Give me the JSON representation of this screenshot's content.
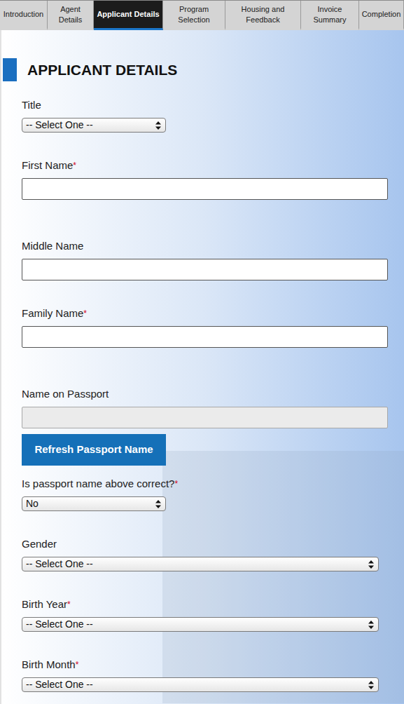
{
  "tabs": [
    {
      "label": "Introduction",
      "selected": false
    },
    {
      "label": "Agent Details",
      "selected": false
    },
    {
      "label": "Applicant Details",
      "selected": true
    },
    {
      "label": "Program Selection",
      "selected": false
    },
    {
      "label": "Housing and Feedback",
      "selected": false
    },
    {
      "label": "Invoice Summary",
      "selected": false
    },
    {
      "label": "Completion",
      "selected": false
    }
  ],
  "section": {
    "title": "APPLICANT DETAILS"
  },
  "required_mark": "*",
  "fields": [
    {
      "kind": "select",
      "label": "Title",
      "required": false,
      "value": "-- Select One --"
    },
    {
      "kind": "text",
      "label": "First Name",
      "required": true,
      "value": ""
    },
    {
      "kind": "text",
      "label": "Middle Name",
      "required": false,
      "value": ""
    },
    {
      "kind": "text",
      "label": "Family Name",
      "required": true,
      "value": ""
    },
    {
      "kind": "readonly",
      "label": "Name on Passport",
      "required": false,
      "value": ""
    },
    {
      "kind": "button",
      "label": "Refresh Passport Name",
      "required": false,
      "value": ""
    },
    {
      "kind": "select",
      "label": "Is passport name above correct?",
      "required": true,
      "value": "No"
    },
    {
      "kind": "select-wide",
      "label": "Gender",
      "required": false,
      "value": "-- Select One --"
    },
    {
      "kind": "select-wide",
      "label": "Birth Year",
      "required": true,
      "value": "-- Select One --"
    },
    {
      "kind": "select-wide",
      "label": "Birth Month",
      "required": true,
      "value": "-- Select One --"
    }
  ]
}
